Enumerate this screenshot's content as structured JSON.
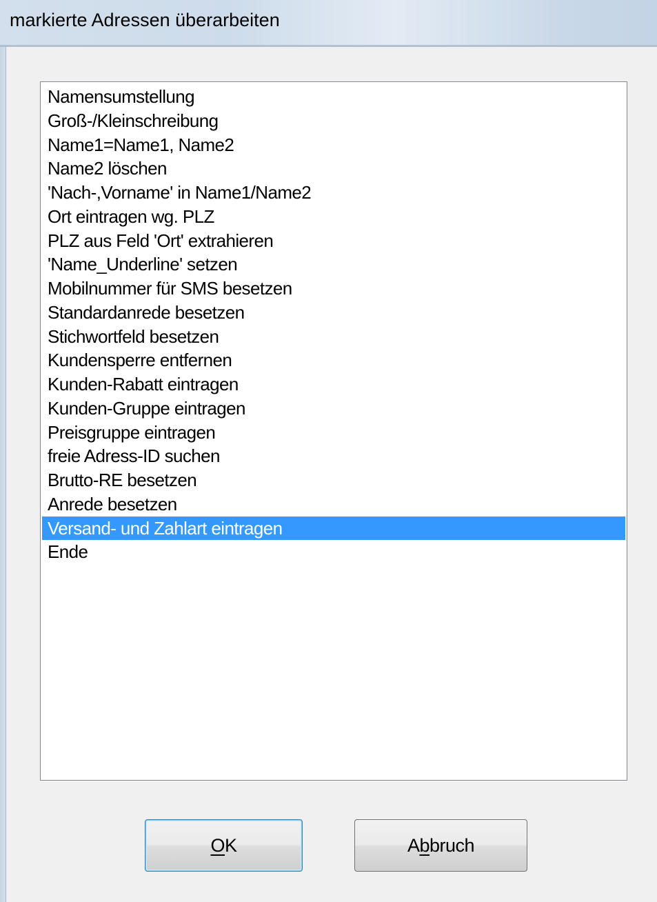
{
  "window": {
    "title": "markierte Adressen überarbeiten"
  },
  "list": {
    "items": [
      "Namensumstellung",
      "Groß-/Kleinschreibung",
      "Name1=Name1, Name2",
      "Name2 löschen",
      "'Nach-,Vorname' in Name1/Name2",
      "Ort eintragen wg. PLZ",
      "PLZ aus Feld 'Ort' extrahieren",
      "'Name_Underline' setzen",
      "Mobilnummer für SMS besetzen",
      "Standardanrede besetzen",
      "Stichwortfeld besetzen",
      "Kundensperre entfernen",
      "Kunden-Rabatt eintragen",
      "Kunden-Gruppe eintragen",
      "Preisgruppe eintragen",
      "freie Adress-ID suchen",
      "Brutto-RE besetzen",
      "Anrede besetzen",
      "Versand- und Zahlart eintragen",
      "Ende"
    ],
    "selected_item": "Versand- und Zahlart eintragen"
  },
  "buttons": {
    "ok": {
      "mnemonic": "O",
      "rest": "K"
    },
    "cancel": {
      "before": "A",
      "mnemonic": "b",
      "after": "bruch"
    }
  },
  "colors": {
    "selection": "#3399ff",
    "selection_text": "#ffffff",
    "dialog_background": "#f0f0f0"
  }
}
